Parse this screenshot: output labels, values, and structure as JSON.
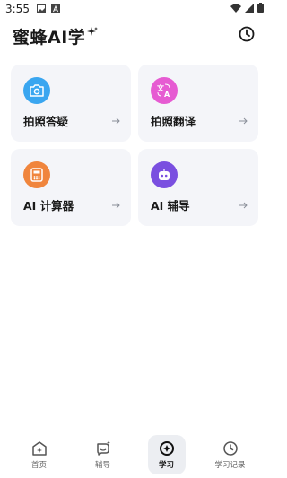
{
  "status_bar": {
    "time": "3:55",
    "icons": [
      "image-icon",
      "font-icon",
      "wifi-icon",
      "cell-signal-icon",
      "battery-icon"
    ]
  },
  "header": {
    "title": "蜜蜂AI学",
    "sparkle_icon": "sparkle-icon",
    "history_icon": "clock-icon"
  },
  "features": [
    {
      "label": "拍照答疑",
      "icon": "camera-icon",
      "color": "#3aa6f0"
    },
    {
      "label": "拍照翻译",
      "icon": "translate-icon",
      "color": "#e65bd2"
    },
    {
      "label": "AI 计算器",
      "icon": "calculator-icon",
      "color": "#f0853d"
    },
    {
      "label": "AI 辅导",
      "icon": "robot-icon",
      "color": "#7a4fe0"
    }
  ],
  "nav": {
    "items": [
      {
        "label": "首页",
        "icon": "home-icon"
      },
      {
        "label": "辅导",
        "icon": "chat-icon"
      },
      {
        "label": "学习",
        "icon": "learn-icon",
        "active": true
      },
      {
        "label": "学习记录",
        "icon": "clock-icon"
      }
    ]
  }
}
